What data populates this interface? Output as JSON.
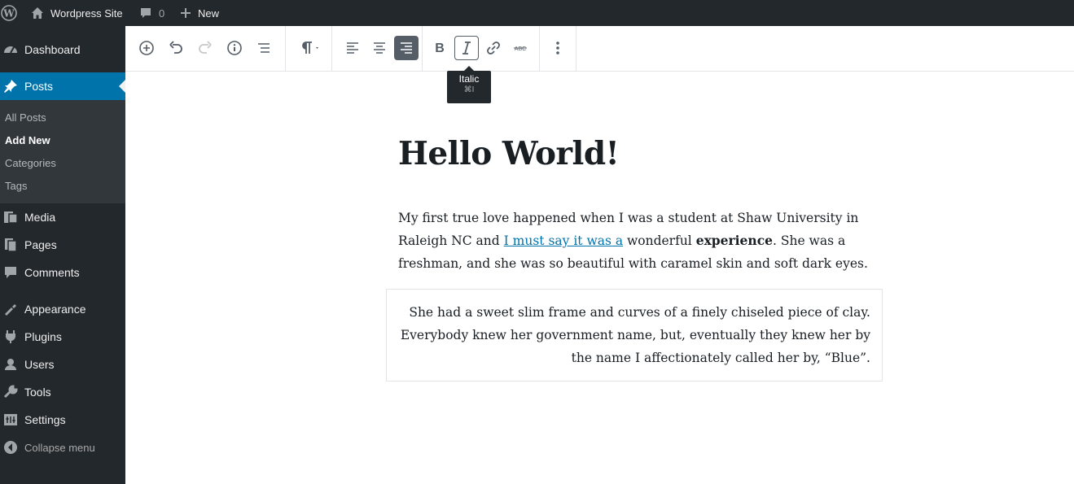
{
  "admin_bar": {
    "site_name": "Wordpress Site",
    "comments_count": "0",
    "new_label": "New"
  },
  "sidebar": {
    "items": [
      {
        "label": "Dashboard",
        "icon": "dashboard-icon"
      },
      {
        "label": "Posts",
        "icon": "pin-icon",
        "current": true
      },
      {
        "label": "Media",
        "icon": "media-icon"
      },
      {
        "label": "Pages",
        "icon": "pages-icon"
      },
      {
        "label": "Comments",
        "icon": "comments-icon"
      },
      {
        "label": "Appearance",
        "icon": "appearance-icon"
      },
      {
        "label": "Plugins",
        "icon": "plugins-icon"
      },
      {
        "label": "Users",
        "icon": "users-icon"
      },
      {
        "label": "Tools",
        "icon": "tools-icon"
      },
      {
        "label": "Settings",
        "icon": "settings-icon"
      }
    ],
    "submenu": [
      "All Posts",
      "Add New",
      "Categories",
      "Tags"
    ],
    "submenu_current": "Add New",
    "collapse_label": "Collapse menu"
  },
  "toolbar": {
    "buttons": [
      "add-block",
      "undo",
      "redo",
      "info",
      "outline",
      "paragraph",
      "align-left",
      "align-center",
      "align-right",
      "bold",
      "italic",
      "link",
      "strikethrough",
      "more"
    ],
    "active": "align-right",
    "focused": "italic"
  },
  "tooltip": {
    "label": "Italic",
    "shortcut": "⌘I"
  },
  "post": {
    "title": "Hello World!",
    "para1_before": "My first true love happened when I was a student at Shaw University in Raleigh NC and ",
    "para1_link": "I must say it was a",
    "para1_mid": " wonderful ",
    "para1_bold": "experience",
    "para1_after": ". She was a freshman, and she was so beautiful with caramel skin and soft dark eyes.",
    "para2": "She had a sweet slim frame and curves of a finely chiseled piece of clay. Everybody knew her government name, but, eventually they knew her by the name I affectionately called her by, “Blue”."
  },
  "colors": {
    "admin_bg": "#23282d",
    "accent": "#0073aa",
    "submenu_bg": "#32373c"
  }
}
